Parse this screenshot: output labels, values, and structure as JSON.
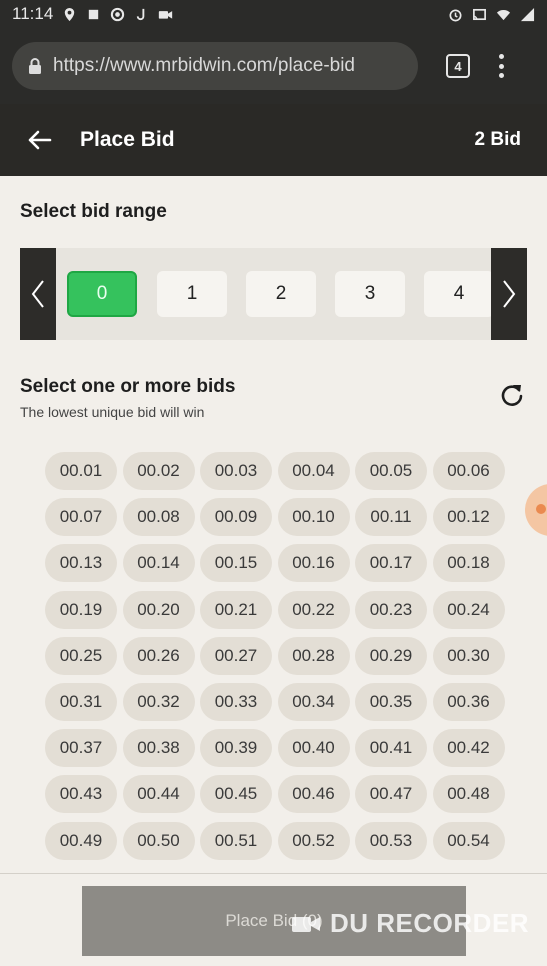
{
  "status_bar": {
    "time": "11:14",
    "icons_left": [
      "location-icon",
      "square-icon",
      "record-icon",
      "j-icon",
      "video-icon"
    ],
    "icons_right": [
      "alarm-icon",
      "cast-icon",
      "wifi-icon",
      "signal-icon"
    ]
  },
  "browser": {
    "url": "https://www.mrbidwin.com/place-bid",
    "tab_count": "4"
  },
  "header": {
    "title": "Place Bid",
    "count": "2 Bid"
  },
  "range": {
    "title": "Select bid range",
    "options": [
      "0",
      "1",
      "2",
      "3",
      "4"
    ],
    "selected": "0"
  },
  "bids": {
    "title": "Select one or more bids",
    "subtitle": "The lowest unique bid will win",
    "values": [
      "00.01",
      "00.02",
      "00.03",
      "00.04",
      "00.05",
      "00.06",
      "00.07",
      "00.08",
      "00.09",
      "00.10",
      "00.11",
      "00.12",
      "00.13",
      "00.14",
      "00.15",
      "00.16",
      "00.17",
      "00.18",
      "00.19",
      "00.20",
      "00.21",
      "00.22",
      "00.23",
      "00.24",
      "00.25",
      "00.26",
      "00.27",
      "00.28",
      "00.29",
      "00.30",
      "00.31",
      "00.32",
      "00.33",
      "00.34",
      "00.35",
      "00.36",
      "00.37",
      "00.38",
      "00.39",
      "00.40",
      "00.41",
      "00.42",
      "00.43",
      "00.44",
      "00.45",
      "00.46",
      "00.47",
      "00.48",
      "00.49",
      "00.50",
      "00.51",
      "00.52",
      "00.53",
      "00.54"
    ]
  },
  "footer": {
    "button_label": "Place Bid (0)"
  },
  "watermark": "DU RECORDER",
  "colors": {
    "header_bg": "#2a2926",
    "content_bg": "#f2efea",
    "selected_chip": "#35c25d",
    "bid_chip": "#e3ded5"
  }
}
